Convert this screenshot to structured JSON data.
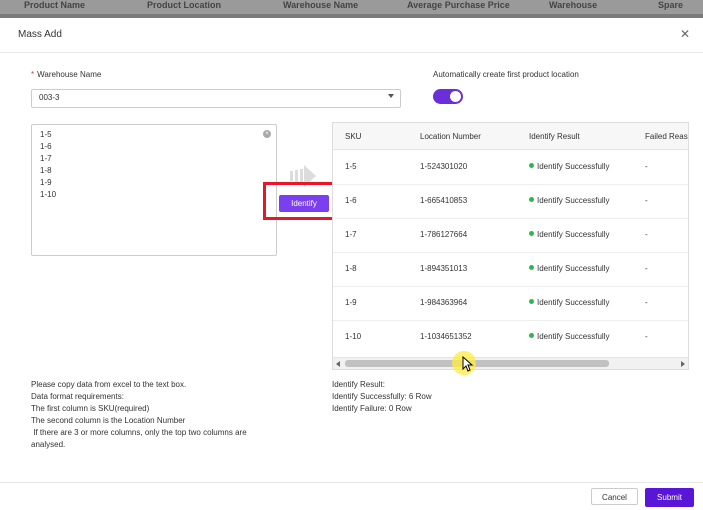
{
  "background_table": {
    "headers": [
      "Product Name",
      "Product Location",
      "Warehouse Name",
      "Average Purchase Price",
      "Warehouse",
      "Spare"
    ]
  },
  "modal": {
    "title": "Mass Add",
    "close_icon": "close-icon"
  },
  "warehouse": {
    "label": "Warehouse Name",
    "required_mark": "*",
    "value": "003-3"
  },
  "auto_location": {
    "label": "Automatically create first product location",
    "enabled": true
  },
  "textbox_lines": [
    "1-5",
    "1-6",
    "1-7",
    "1-8",
    "1-9",
    "1-10"
  ],
  "identify_button": "Identify",
  "result_table": {
    "headers": [
      "SKU",
      "Location Number",
      "Identify Result",
      "Failed Reas"
    ],
    "rows": [
      {
        "sku": "1-5",
        "location": "1-524301020",
        "result": "Identify Successfully",
        "failed": "-"
      },
      {
        "sku": "1-6",
        "location": "1-665410853",
        "result": "Identify Successfully",
        "failed": "-"
      },
      {
        "sku": "1-7",
        "location": "1-786127664",
        "result": "Identify Successfully",
        "failed": "-"
      },
      {
        "sku": "1-8",
        "location": "1-894351013",
        "result": "Identify Successfully",
        "failed": "-"
      },
      {
        "sku": "1-9",
        "location": "1-984363964",
        "result": "Identify Successfully",
        "failed": "-"
      },
      {
        "sku": "1-10",
        "location": "1-1034651352",
        "result": "Identify Successfully",
        "failed": "-"
      }
    ]
  },
  "instructions": [
    "Please copy data from excel to the text box.",
    "Data format requirements:",
    "The first column is SKU(required)",
    "The second column is the Location Number",
    " If there are 3 or more columns, only the top two columns are",
    "analysed."
  ],
  "identify_summary": {
    "title": "Identify Result:",
    "success": "Identify Successfully: 6 Row",
    "failure": "Identify Failure: 0 Row"
  },
  "footer": {
    "cancel": "Cancel",
    "submit": "Submit"
  },
  "colors": {
    "accent": "#7b3ff2",
    "submit": "#5a16d8",
    "success_dot": "#2db84d",
    "highlight_box": "#e8152b"
  }
}
